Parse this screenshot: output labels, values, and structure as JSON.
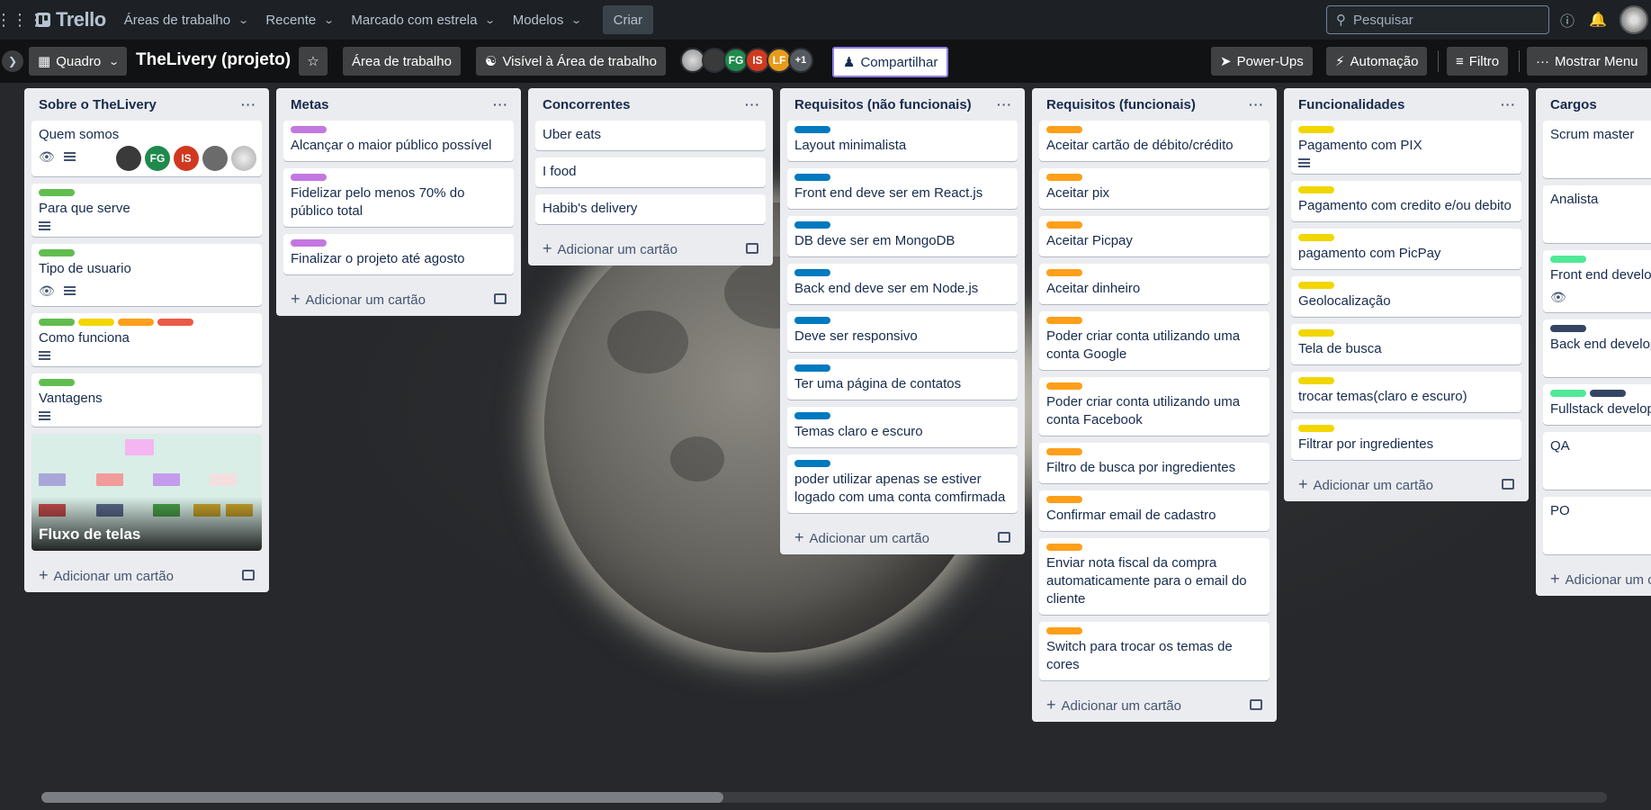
{
  "topnav": {
    "logo": "Trello",
    "menus": [
      "Áreas de trabalho",
      "Recente",
      "Marcado com estrela",
      "Modelos"
    ],
    "create": "Criar",
    "search_placeholder": "Pesquisar"
  },
  "board": {
    "view": "Quadro",
    "title": "TheLivery (projeto)",
    "workspace": "Área de trabalho",
    "visibility": "Visível à Área de trabalho",
    "members": [
      "FG",
      "IS",
      "LF"
    ],
    "members_more": "+1",
    "share": "Compartilhar",
    "powerups": "Power-Ups",
    "automation": "Automação",
    "filter": "Filtro",
    "menu": "Mostrar Menu"
  },
  "add_card": "Adicionar um cartão",
  "add_card_partial": "Adicionar um c",
  "colors": {
    "green": "#61bd4f",
    "yellow": "#f2d600",
    "orange": "#ff9f1a",
    "red": "#eb5a46",
    "purple": "#c377e0",
    "blue": "#0079bf",
    "navy": "#344563",
    "lime": "#51e898"
  },
  "lists": [
    {
      "title": "Sobre o TheLivery",
      "cards": [
        {
          "title": "Quem somos"
        },
        {
          "title": "Para que serve"
        },
        {
          "title": "Tipo de usuario"
        },
        {
          "title": "Como funciona"
        },
        {
          "title": "Vantagens"
        },
        {
          "title": "Fluxo de telas"
        }
      ]
    },
    {
      "title": "Metas",
      "cards": [
        {
          "title": "Alcançar o maior público possível"
        },
        {
          "title": "Fidelizar pelo menos 70% do público total"
        },
        {
          "title": "Finalizar o projeto até agosto"
        }
      ]
    },
    {
      "title": "Concorrentes",
      "cards": [
        {
          "title": "Uber eats"
        },
        {
          "title": "I food"
        },
        {
          "title": "Habib's delivery"
        }
      ]
    },
    {
      "title": "Requisitos (não funcionais)",
      "cards": [
        {
          "title": "Layout minimalista"
        },
        {
          "title": "Front end deve ser em React.js"
        },
        {
          "title": "DB deve ser em MongoDB"
        },
        {
          "title": "Back end deve ser em Node.js"
        },
        {
          "title": "Deve ser responsivo"
        },
        {
          "title": "Ter uma página de contatos"
        },
        {
          "title": "Temas claro e escuro"
        },
        {
          "title": "poder utilizar apenas se estiver logado com uma conta comfirmada"
        }
      ]
    },
    {
      "title": "Requisitos (funcionais)",
      "cards": [
        {
          "title": "Aceitar cartão de débito/crédito"
        },
        {
          "title": "Aceitar pix"
        },
        {
          "title": "Aceitar Picpay"
        },
        {
          "title": "Aceitar dinheiro"
        },
        {
          "title": "Poder criar conta utilizando uma conta Google"
        },
        {
          "title": "Poder criar conta utilizando uma conta Facebook"
        },
        {
          "title": "Filtro de busca por ingredientes"
        },
        {
          "title": "Confirmar email de cadastro"
        },
        {
          "title": "Enviar nota fiscal da compra automaticamente para o email do cliente"
        },
        {
          "title": "Switch para trocar os temas de cores"
        }
      ]
    },
    {
      "title": "Funcionalidades",
      "cards": [
        {
          "title": "Pagamento com PIX"
        },
        {
          "title": "Pagamento com credito e/ou debito"
        },
        {
          "title": "pagamento com PicPay"
        },
        {
          "title": "Geolocalização"
        },
        {
          "title": "Tela de busca"
        },
        {
          "title": "trocar temas(claro e escuro)"
        },
        {
          "title": "Filtrar por ingredientes"
        }
      ]
    },
    {
      "title": "Cargos",
      "cards": [
        {
          "title": "Scrum master"
        },
        {
          "title": "Analista"
        },
        {
          "title": "Front end develop"
        },
        {
          "title": "Back end develop"
        },
        {
          "title": "Fullstack develope"
        },
        {
          "title": "QA"
        },
        {
          "title": "PO"
        }
      ]
    }
  ]
}
